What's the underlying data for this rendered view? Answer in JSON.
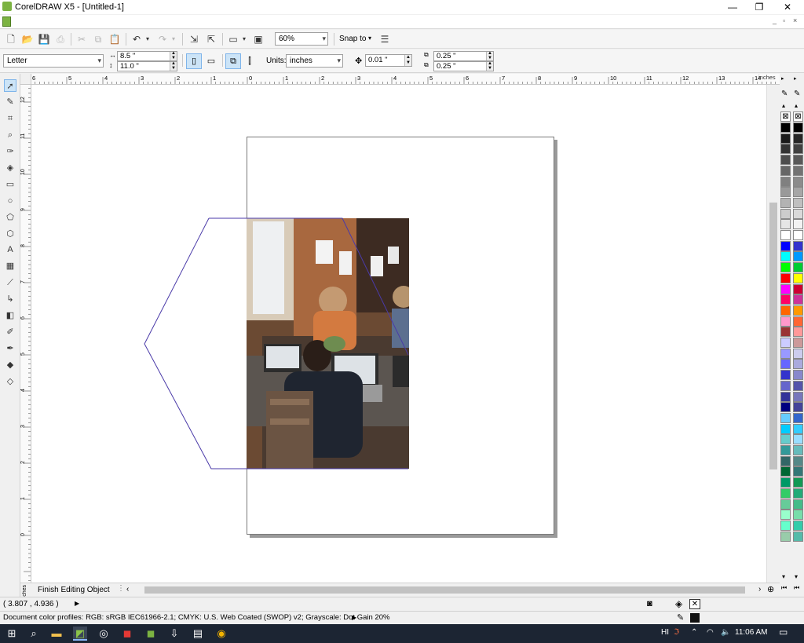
{
  "window": {
    "title": "CorelDRAW X5 - [Untitled-1]"
  },
  "standard_toolbar": {
    "zoom": "60%",
    "snap_to": "Snap to"
  },
  "property_bar": {
    "paper_type": "Letter",
    "width": "8.5 \"",
    "height": "11.0 \"",
    "units_label": "Units:",
    "units": "inches",
    "nudge": "0.01 \"",
    "dup_x": "0.25 \"",
    "dup_y": "0.25 \""
  },
  "rulers": {
    "h_labels": [
      "6",
      "5",
      "4",
      "3",
      "2",
      "1",
      "0",
      "1",
      "2",
      "3",
      "4",
      "5",
      "6",
      "7",
      "8",
      "9",
      "10",
      "11",
      "12",
      "13",
      "14"
    ],
    "h_unit": "inches",
    "v_labels": [
      "12",
      "11",
      "10",
      "9",
      "8",
      "7",
      "6",
      "5",
      "4",
      "3",
      "2",
      "1",
      "0"
    ],
    "v_unit": "inches"
  },
  "bottom": {
    "doc_tab": "Finish Editing Object"
  },
  "status": {
    "coordinates": "( 3.807 , 4.936 )",
    "color_profiles": "Document color profiles: RGB: sRGB IEC61966-2.1; CMYK: U.S. Web Coated (SWOP) v2; Grayscale: Dot Gain 20%"
  },
  "taskbar": {
    "lang": "HI",
    "time": "11:06 AM"
  },
  "palette": {
    "col1": [
      "#000000",
      "#1a1a1a",
      "#333333",
      "#4d4d4d",
      "#666666",
      "#808080",
      "#999999",
      "#b3b3b3",
      "#cccccc",
      "#e6e6e6",
      "#ffffff",
      "#0000ff",
      "#00ffff",
      "#00ff00",
      "#ff0000",
      "#ff00ff",
      "#ff0066",
      "#ff6600",
      "#ff99cc",
      "#993333",
      "#ccccff",
      "#9999ff",
      "#6666ff",
      "#3333cc",
      "#6666cc",
      "#333399",
      "#000080",
      "#66ccff",
      "#00ccff",
      "#66cccc",
      "#339999",
      "#336666",
      "#006633",
      "#009966",
      "#33cc66",
      "#66cc99",
      "#99ffcc",
      "#66ffcc",
      "#99ccaa"
    ],
    "col2": [
      "#000000",
      "#262626",
      "#404040",
      "#595959",
      "#737373",
      "#8c8c8c",
      "#a6a6a6",
      "#bfbfbf",
      "#d9d9d9",
      "#f2f2f2",
      "#ffffff",
      "#3333cc",
      "#0099ff",
      "#00cc33",
      "#ffff00",
      "#cc0033",
      "#cc3399",
      "#ff9900",
      "#ff6633",
      "#ff9999",
      "#cc9999",
      "#ccccee",
      "#aaaadd",
      "#8888cc",
      "#5555aa",
      "#7777bb",
      "#444499",
      "#3366cc",
      "#33ccff",
      "#99ddff",
      "#66bbbb",
      "#558888",
      "#337777",
      "#119955",
      "#22aa77",
      "#44bb88",
      "#77ddaa",
      "#33ccaa",
      "#55bbaa"
    ]
  }
}
